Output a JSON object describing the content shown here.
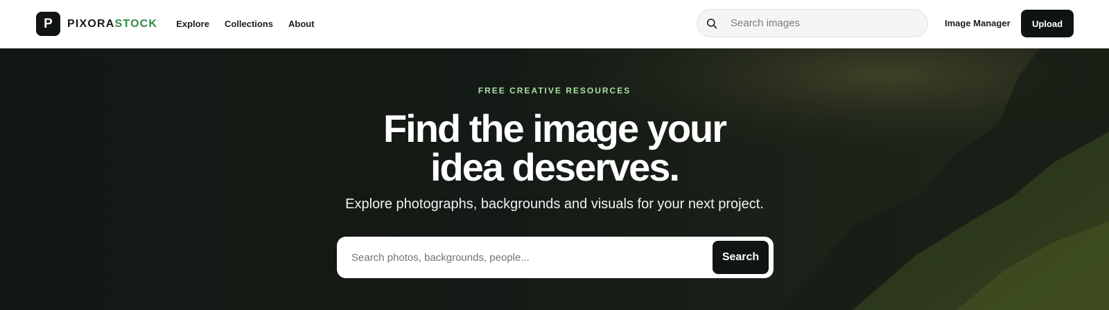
{
  "brand": {
    "mark": "P",
    "name_part1": "PIXORA",
    "name_part2": "STOCK",
    "accent_color": "#2f8a45"
  },
  "nav": {
    "items": [
      {
        "label": "Explore"
      },
      {
        "label": "Collections"
      },
      {
        "label": "About"
      }
    ]
  },
  "top_search": {
    "placeholder": "Search images",
    "icon": "search-icon"
  },
  "header_actions": {
    "image_manager": "Image Manager",
    "upload": "Upload"
  },
  "hero": {
    "eyebrow": "FREE CREATIVE RESOURCES",
    "headline": "Find the image your idea deserves.",
    "subline": "Explore photographs, backgrounds and visuals for your next project.",
    "search_placeholder": "Search photos, backgrounds, people...",
    "search_button": "Search",
    "eyebrow_color": "#a7e3a4"
  }
}
